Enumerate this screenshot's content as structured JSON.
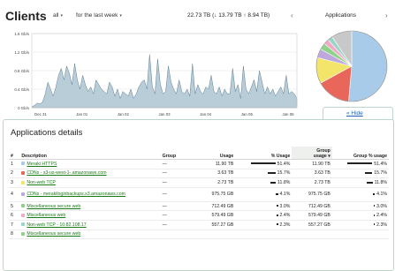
{
  "header": {
    "title": "Clients",
    "filter_all": "all",
    "timeframe": "for the last week",
    "totals": "22.73 TB (↓ 13.79 TB ↑ 8.94 TB)",
    "prev_arrow": "‹",
    "next_arrow": "›",
    "apps_dropdown": "Applications"
  },
  "chart_data": {
    "type": "area",
    "ylabels": [
      "1.6 Gb/s",
      "1.2 Gb/s",
      "0.8 Gb/s",
      "0.4 Gb/s",
      "0 Gb/s"
    ],
    "xlabels": [
      "Dec 31",
      "Jan 01",
      "Jan 02",
      "Jan 03",
      "Jan 04",
      "Jan 05",
      "Jan 06"
    ],
    "ylim": [
      0,
      1.6
    ],
    "yunit": "Gb/s",
    "color": "#b9cdd9",
    "line_color": "#5f7f93",
    "values": [
      0.02,
      0.05,
      0.1,
      0.08,
      0.12,
      0.3,
      0.55,
      0.4,
      0.25,
      0.45,
      0.7,
      0.85,
      0.6,
      0.9,
      0.75,
      0.5,
      0.95,
      0.6,
      0.4,
      0.7,
      0.5,
      0.35,
      0.45,
      0.3,
      0.6,
      0.5,
      0.4,
      0.35,
      0.3,
      0.55,
      0.45,
      0.25,
      0.4,
      0.2,
      0.35,
      0.3,
      0.25,
      0.4,
      0.2,
      0.3,
      0.45,
      0.55,
      0.6,
      0.4,
      1.15,
      0.45,
      0.3,
      1.05,
      0.5,
      0.3,
      0.35,
      0.9,
      0.55,
      0.4,
      0.3,
      0.6,
      0.35,
      0.3,
      0.4,
      0.25,
      0.95,
      0.3,
      0.5,
      0.35,
      0.3,
      0.45,
      0.4,
      0.7,
      0.35,
      0.3,
      0.45,
      0.25,
      0.4,
      0.3,
      0.3,
      0.85,
      0.35,
      0.5,
      0.2,
      0.9,
      0.4,
      0.3,
      0.45,
      0.6,
      0.35,
      0.8,
      0.55,
      0.3,
      0.45,
      0.3,
      0.4,
      0.25,
      0.35,
      0.45,
      0.3,
      0.7,
      0.3,
      0.35,
      0.3,
      0.2
    ]
  },
  "pie": {
    "slices": [
      {
        "value": 51.4,
        "color": "#a7cbe8"
      },
      {
        "value": 15.7,
        "color": "#e8665a"
      },
      {
        "value": 11.8,
        "color": "#f3e46a"
      },
      {
        "value": 4.1,
        "color": "#bfa8dd"
      },
      {
        "value": 3.0,
        "color": "#8fd38a"
      },
      {
        "value": 2.4,
        "color": "#f2a9c6"
      },
      {
        "value": 2.3,
        "color": "#9ad6c8"
      },
      {
        "value": 9.3,
        "color": "#c8c8c8"
      }
    ]
  },
  "hide_link": "« Hide",
  "details": {
    "title": "Applications details",
    "columns": {
      "idx": "#",
      "description": "Description",
      "group": "Group",
      "usage": "Usage",
      "pct_usage": "% Usage",
      "group_usage_1": "Group",
      "group_usage_2": "usage ▾",
      "group_pct": "Group % usage"
    },
    "rows": [
      {
        "idx": "1",
        "color": "#a7cbe8",
        "desc": "Meraki HTTPS",
        "group": "—",
        "usage": "11.90 TB",
        "pct": "51.4%",
        "pct_bar": 51.4,
        "gusage": "11.90 TB",
        "gpct": "51.4%"
      },
      {
        "idx": "2",
        "color": "#e8665a",
        "desc": "CDNs - s3-us-west-1-.amazonaws.com",
        "group": "—",
        "usage": "3.63 TB",
        "pct": "15.7%",
        "pct_bar": 15.7,
        "gusage": "3.63 TB",
        "gpct": "15.7%"
      },
      {
        "idx": "3",
        "color": "#f3e46a",
        "desc": "Non-web TCP",
        "group": "—",
        "usage": "2.73 TB",
        "pct": "11.8%",
        "pct_bar": 11.8,
        "gusage": "2.73 TB",
        "gpct": "11.8%"
      },
      {
        "idx": "4",
        "color": "#bfa8dd",
        "desc": "CDNs - merakiloginbackups.s3.amazonaws.com",
        "group": "—",
        "usage": "975.75 GB",
        "pct": "4.1%",
        "pct_bar": 4.1,
        "gusage": "975.75 GB",
        "gpct": "4.1%",
        "tall": true
      },
      {
        "idx": "5",
        "color": "#8fd38a",
        "desc": "Miscellaneous secure web",
        "group": "—",
        "usage": "712.49 GB",
        "pct": "3.0%",
        "pct_bar": 3.0,
        "gusage": "712.49 GB",
        "gpct": "3.0%"
      },
      {
        "idx": "6",
        "color": "#f2a9c6",
        "desc": "Miscellaneous web",
        "group": "—",
        "usage": "579.49 GB",
        "pct": "2.4%",
        "pct_bar": 2.4,
        "gusage": "579.49 GB",
        "gpct": "2.4%"
      },
      {
        "idx": "7",
        "color": "#9ad6c8",
        "desc": "Non-web TCP - 10.82.108.17",
        "group": "—",
        "usage": "557.27 GB",
        "pct": "2.3%",
        "pct_bar": 2.3,
        "gusage": "557.27 GB",
        "gpct": "2.3%"
      },
      {
        "idx": "8",
        "color": "#8fd38a",
        "desc": "Miscellaneous secure web",
        "group": "",
        "usage": "",
        "pct": "",
        "pct_bar": 0,
        "gusage": "",
        "gpct": ""
      }
    ]
  }
}
